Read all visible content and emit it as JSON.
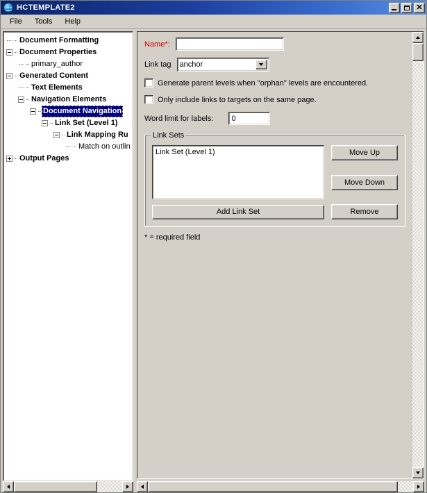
{
  "window": {
    "title": "HCTEMPLATE2",
    "icon": "globe-icon",
    "minimize_label": "_",
    "maximize_label": "□",
    "close_label": "✕"
  },
  "menu": {
    "items": [
      {
        "label": "File"
      },
      {
        "label": "Tools"
      },
      {
        "label": "Help"
      }
    ]
  },
  "tree": {
    "nodes": [
      {
        "label": "Document Formatting",
        "depth": 0,
        "toggle": "none",
        "bold": true,
        "selected": false
      },
      {
        "label": "Document Properties",
        "depth": 0,
        "toggle": "expanded",
        "bold": true,
        "selected": false
      },
      {
        "label": "primary_author",
        "depth": 1,
        "toggle": "none",
        "bold": false,
        "selected": false
      },
      {
        "label": "Generated Content",
        "depth": 0,
        "toggle": "expanded",
        "bold": true,
        "selected": false
      },
      {
        "label": "Text Elements",
        "depth": 1,
        "toggle": "none",
        "bold": true,
        "selected": false
      },
      {
        "label": "Navigation Elements",
        "depth": 1,
        "toggle": "expanded",
        "bold": true,
        "selected": false
      },
      {
        "label": "Document Navigation",
        "depth": 2,
        "toggle": "expanded",
        "bold": true,
        "selected": true
      },
      {
        "label": "Link Set (Level 1)",
        "depth": 3,
        "toggle": "expanded",
        "bold": true,
        "selected": false
      },
      {
        "label": "Link Mapping Ru",
        "depth": 4,
        "toggle": "expanded",
        "bold": true,
        "selected": false
      },
      {
        "label": "Match on outlin",
        "depth": 5,
        "toggle": "none",
        "bold": false,
        "selected": false
      },
      {
        "label": "Output Pages",
        "depth": 0,
        "toggle": "collapsed",
        "bold": true,
        "selected": false
      }
    ]
  },
  "form": {
    "name_label": "Name*:",
    "name_value": "",
    "name_placeholder": "",
    "linktag_label": "Link tag",
    "linktag_value": "anchor",
    "checkbox_orphan_label": "Generate parent levels when \"orphan\" levels are encountered.",
    "checkbox_orphan_checked": false,
    "checkbox_samepage_label": "Only include links to targets on the same page.",
    "checkbox_samepage_checked": false,
    "wordlimit_label": "Word limit for labels:",
    "wordlimit_value": "0",
    "required_note": "* = required field"
  },
  "link_sets": {
    "legend": "Link Sets",
    "items": [
      {
        "label": "Link Set (Level 1)",
        "selected": false
      }
    ],
    "move_up_label": "Move Up",
    "move_down_label": "Move Down",
    "remove_label": "Remove",
    "add_label": "Add Link Set"
  },
  "colors": {
    "face": "#d4d0c8",
    "title_start": "#0a246a",
    "title_end": "#5b8fe0",
    "selection": "#000080",
    "required_text": "#d00000",
    "field_bg": "#ffffff"
  }
}
